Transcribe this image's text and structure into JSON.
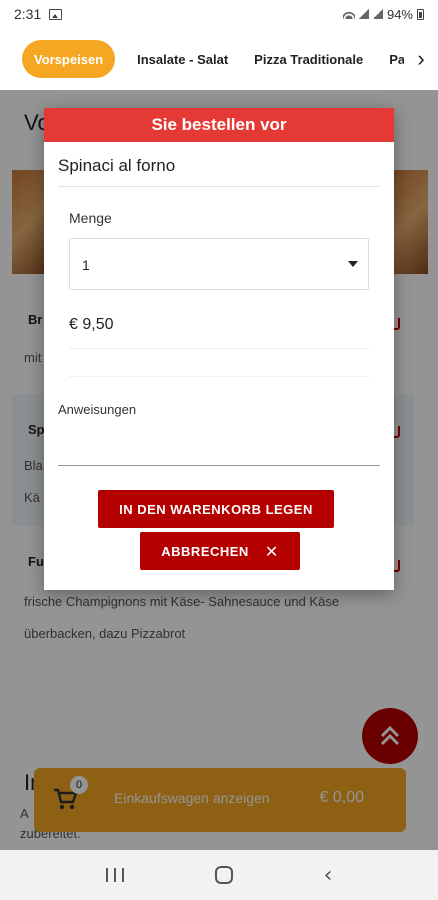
{
  "status_bar": {
    "time": "2:31",
    "battery": "94%"
  },
  "tabs": [
    {
      "label": "Vorspeisen",
      "active": true
    },
    {
      "label": "Insalate - Salat",
      "active": false
    },
    {
      "label": "Pizza Traditionale",
      "active": false
    },
    {
      "label": "Pa",
      "active": false
    }
  ],
  "page": {
    "heading": "Vo",
    "cards": [
      {
        "title": "Br",
        "desc": "mit"
      },
      {
        "title": "Sp",
        "desc_line1": "Bla",
        "desc_line2": "Kä"
      },
      {
        "title": "Fu",
        "desc": "frische Champignons mit Käse- Sahnesauce und Käse überbacken, dazu Pizzabrot"
      }
    ],
    "section_heading": "In",
    "section_desc_1": "A",
    "section_desc_2": "zubereitet."
  },
  "cart": {
    "count": "0",
    "label": "Einkaufswagen anzeigen",
    "total": "€ 0,00"
  },
  "dialog": {
    "title": "Sie bestellen vor",
    "product": "Spinaci al forno",
    "quantity_label": "Menge",
    "quantity_value": "1",
    "price": "€ 9,50",
    "instructions_label": "Anweisungen",
    "instructions_value": "",
    "add_button": "IN DEN WARENKORB LEGEN",
    "cancel_button": "ABBRECHEN"
  },
  "colors": {
    "accent": "#f5a623",
    "primary_red": "#b50000",
    "header_red": "#e53935"
  }
}
